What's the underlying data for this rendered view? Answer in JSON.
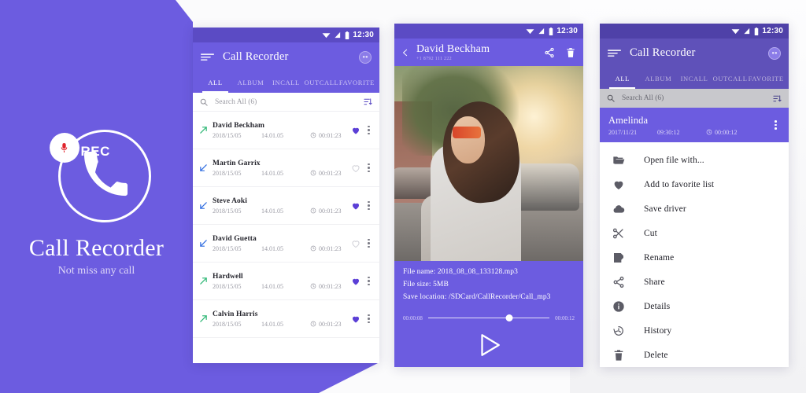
{
  "brand": {
    "title": "Call Recorder",
    "subtitle": "Not miss any call",
    "rec_label": "REC",
    "accent": "#6c5ce0"
  },
  "status_bar": {
    "time": "12:30"
  },
  "screen1": {
    "appbar": {
      "title": "Call Recorder",
      "menu_icon": "hamburger-icon",
      "avatar_icon": "account-avatar"
    },
    "tabs": [
      {
        "label": "ALL",
        "active": true
      },
      {
        "label": "ALBUM",
        "active": false
      },
      {
        "label": "INCALL",
        "active": false
      },
      {
        "label": "OUTCALL",
        "active": false
      },
      {
        "label": "FAVORITE",
        "active": false
      }
    ],
    "search": {
      "placeholder": "Search All (6)",
      "icon": "search-icon",
      "sort_icon": "sort-icon"
    },
    "rows": [
      {
        "name": "David Beckham",
        "date": "2018/15/05",
        "time": "14.01.05",
        "duration": "00:01:23",
        "direction": "out",
        "favorite": true
      },
      {
        "name": "Martin Garrix",
        "date": "2018/15/05",
        "time": "14.01.05",
        "duration": "00:01:23",
        "direction": "in",
        "favorite": false
      },
      {
        "name": "Steve Aoki",
        "date": "2018/15/05",
        "time": "14.01.05",
        "duration": "00:01:23",
        "direction": "in",
        "favorite": true
      },
      {
        "name": "David Guetta",
        "date": "2018/15/05",
        "time": "14.01.05",
        "duration": "00:01:23",
        "direction": "in",
        "favorite": false
      },
      {
        "name": "Hardwell",
        "date": "2018/15/05",
        "time": "14.01.05",
        "duration": "00:01:23",
        "direction": "out",
        "favorite": true
      },
      {
        "name": "Calvin Harris",
        "date": "2018/15/05",
        "time": "14.01.05",
        "duration": "00:01:23",
        "direction": "out",
        "favorite": true
      }
    ]
  },
  "screen2": {
    "appbar": {
      "back_icon": "back-chevron-icon",
      "contact_name": "David Beckham",
      "phone_number": "+1 8792 111 222",
      "share_icon": "share-icon",
      "delete_icon": "trash-icon"
    },
    "file_info": {
      "name_label": "File name:",
      "name_value": "2018_08_08_133128.mp3",
      "size_label": "File size:",
      "size_value": "5MB",
      "location_label": "Save location:",
      "location_value": "/SDCard/CallRecorder/Call_mp3"
    },
    "player": {
      "elapsed": "00:00:08",
      "total": "00:00:12",
      "progress_percent": 67,
      "play_icon": "play-icon"
    }
  },
  "screen3": {
    "appbar": {
      "title": "Call Recorder",
      "menu_icon": "hamburger-icon",
      "avatar_icon": "account-avatar"
    },
    "tabs": [
      {
        "label": "ALL",
        "active": true
      },
      {
        "label": "ALBUM",
        "active": false
      },
      {
        "label": "INCALL",
        "active": false
      },
      {
        "label": "OUTCALL",
        "active": false
      },
      {
        "label": "FAVORITE",
        "active": false
      }
    ],
    "search": {
      "placeholder": "Search All (6)",
      "icon": "search-icon",
      "sort_icon": "sort-icon"
    },
    "selected_row": {
      "name": "Amelinda",
      "date": "2017/11/21",
      "time": "09:30:12",
      "duration": "00:00:12"
    },
    "menu_items": [
      {
        "label": "Open file with...",
        "icon": "folder-open-icon"
      },
      {
        "label": "Add to favorite list",
        "icon": "heart-icon"
      },
      {
        "label": "Save driver",
        "icon": "cloud-upload-icon"
      },
      {
        "label": "Cut",
        "icon": "scissors-icon"
      },
      {
        "label": "Rename",
        "icon": "rename-icon"
      },
      {
        "label": "Share",
        "icon": "share-icon"
      },
      {
        "label": "Details",
        "icon": "info-icon"
      },
      {
        "label": "History",
        "icon": "history-icon"
      },
      {
        "label": "Delete",
        "icon": "trash-icon"
      }
    ]
  }
}
